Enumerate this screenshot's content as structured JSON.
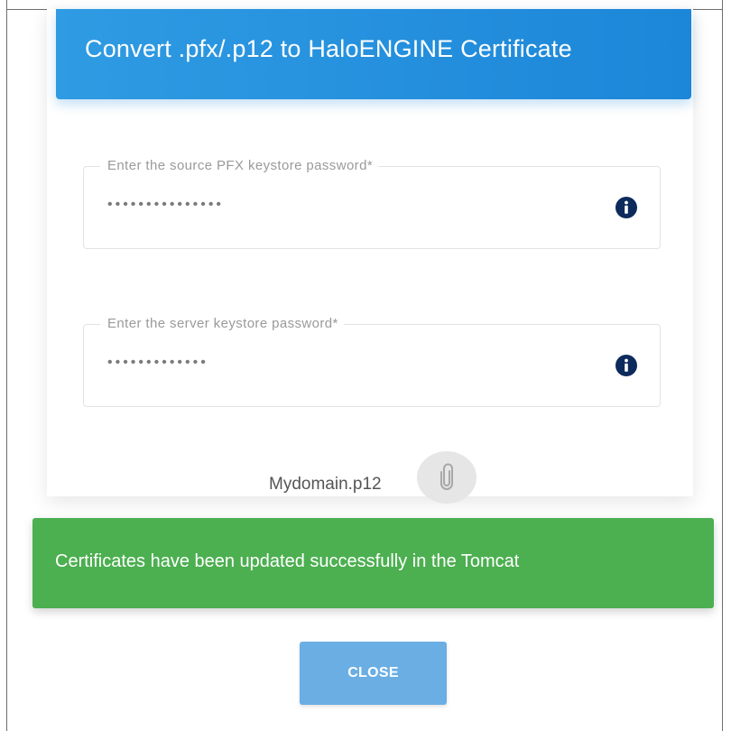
{
  "dialog": {
    "title": "Convert .pfx/.p12 to HaloENGINE Certificate"
  },
  "fields": [
    {
      "label": "Enter the source PFX keystore password*",
      "value": "•••••••••••••••",
      "icon": "info-icon"
    },
    {
      "label": "Enter the server keystore password*",
      "value": "•••••••••••••",
      "icon": "info-icon"
    }
  ],
  "attachment": {
    "file_name": "Mydomain.p12",
    "icon": "paperclip-icon"
  },
  "toast": {
    "message": "Certificates have been updated successfully in the Tomcat",
    "color": "#4caf50"
  },
  "actions": {
    "close_label": "CLOSE"
  },
  "colors": {
    "header": "#1c86d8",
    "info_icon": "#0d2a5c",
    "close_button": "#6aaee4"
  }
}
